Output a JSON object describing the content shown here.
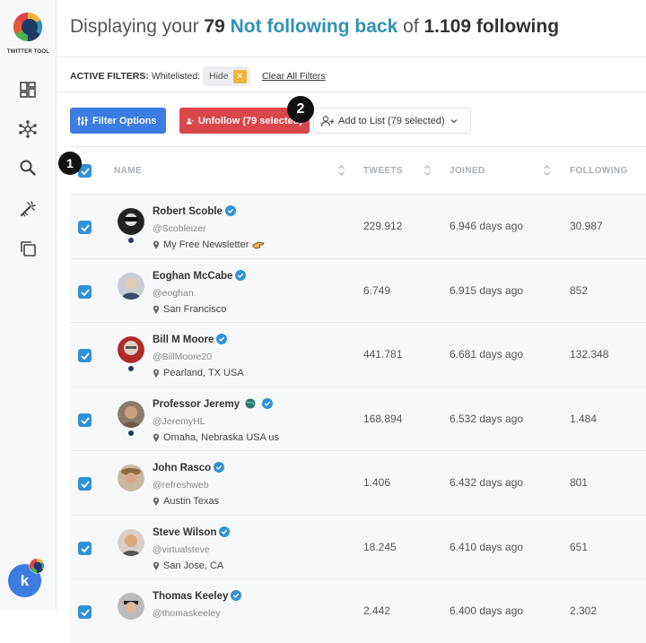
{
  "app": {
    "logo_text": "TWITTER TOOL",
    "user_initial": "k"
  },
  "sidebar": {
    "items": [
      {
        "icon": "dashboard-icon"
      },
      {
        "icon": "network-icon"
      },
      {
        "icon": "search-icon"
      },
      {
        "icon": "magic-wand-icon"
      },
      {
        "icon": "copy-icon"
      }
    ]
  },
  "header": {
    "prefix": "Displaying your",
    "count": "79",
    "filter_name": "Not following back",
    "middle": "of",
    "total": "1.109 following"
  },
  "filters": {
    "label": "ACTIVE FILTERS:",
    "whitelisted_label": "Whitelisted:",
    "chip": "Hide",
    "clear": "Clear All Filters"
  },
  "toolbar": {
    "filter_options": "Filter Options",
    "unfollow": "Unfollow (79 selected)",
    "add_to_list": "Add to List (79 selected)"
  },
  "markers": {
    "one": "1",
    "two": "2"
  },
  "table": {
    "columns": [
      "NAME",
      "TWEETS",
      "JOINED",
      "FOLLOWING"
    ],
    "rows": [
      {
        "name": "Robert Scoble",
        "handle": "@Scobleizer",
        "location": "My Free Newsletter",
        "tweets": "229.912",
        "joined": "6.946 days ago",
        "following": "30.987",
        "dot": true,
        "extra_icon": "pointing-hand-icon"
      },
      {
        "name": "Eoghan McCabe",
        "handle": "@eoghan",
        "location": "San Francisco",
        "tweets": "6.749",
        "joined": "6.915 days ago",
        "following": "852",
        "dot": false
      },
      {
        "name": "Bill M Moore",
        "handle": "@BillMoore20",
        "location": "Pearland, TX USA",
        "tweets": "441.781",
        "joined": "6.681 days ago",
        "following": "132.348",
        "dot": true
      },
      {
        "name": "Professor Jeremy",
        "handle": "@JeremyHL",
        "location": "Omaha, Nebraska USA us",
        "tweets": "168.894",
        "joined": "6.532 days ago",
        "following": "1.484",
        "dot": true,
        "extra_icon": "globe-icon"
      },
      {
        "name": "John Rasco",
        "handle": "@refreshweb",
        "location": "Austin Texas",
        "tweets": "1.406",
        "joined": "6.432 days ago",
        "following": "801",
        "dot": false
      },
      {
        "name": "Steve Wilson",
        "handle": "@virtualsteve",
        "location": "San Jose, CA",
        "tweets": "18.245",
        "joined": "6.410 days ago",
        "following": "651",
        "dot": false
      },
      {
        "name": "Thomas Keeley",
        "handle": "@thomaskeeley",
        "location": "",
        "tweets": "2.442",
        "joined": "6.400 days ago",
        "following": "2.302",
        "dot": false
      }
    ]
  },
  "colors": {
    "accent": "#3191b8",
    "primary": "#3d7ce0",
    "danger": "#d9464b",
    "warning": "#f0b43c"
  }
}
